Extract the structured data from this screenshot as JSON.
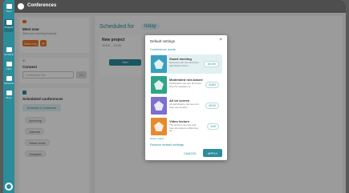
{
  "topbar": {
    "title": "Conferences"
  },
  "rail": {
    "items": [
      "Tours",
      "Projects",
      "Contacts",
      "Calls",
      "Schedule",
      "More"
    ]
  },
  "left": {
    "meet_title": "Meet now",
    "meet_sub": "Start your meeting instantly",
    "start_label": "Start now",
    "id_label": "ID",
    "connect_label": "Connect",
    "connect_placeholder": "Conference link",
    "connect_btn": "Go",
    "scheduled_label": "Scheduled conferences",
    "schedule_btn": "Schedule a Conference",
    "upcoming": "Upcoming",
    "calendar": "Calendar",
    "virtual_rooms": "Virtual rooms",
    "templates": "Templates"
  },
  "main": {
    "scheduled_for": "Scheduled for",
    "today": "today",
    "project_title": "New project",
    "project_time": "20:00 – 19:30",
    "start": "Start"
  },
  "modal": {
    "title": "Default settings",
    "close": "×",
    "mode": "Conference mode",
    "options": [
      {
        "name": "Smart meeting",
        "desc": "Everyone can see and hear participants when...",
        "num": "16/100",
        "color": "#3a9fbf"
      },
      {
        "name": "Moderated role-based",
        "desc": "Participants can see and hear only the speakers a...",
        "num": "4/400",
        "color": "#2fa48a"
      },
      {
        "name": "All on screen",
        "desc": "All participants can see and hear one another",
        "num": "40/40",
        "color": "#7b6fd0"
      },
      {
        "name": "Video lecture",
        "desc": "The lecturer can see and hear all students while they ca...",
        "num": "1/49",
        "color": "#e58a2e"
      }
    ],
    "other": "Other modes",
    "restore": "Restore default settings",
    "cancel": "CANCEL",
    "apply": "APPLY"
  }
}
